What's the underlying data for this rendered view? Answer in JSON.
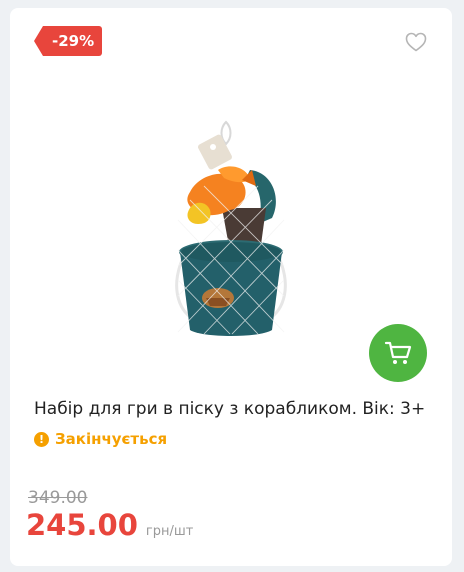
{
  "product": {
    "discount_badge": "-29%",
    "title": "Набір для гри в піску з корабликом. Вік: 3+",
    "stock_status": "Закінчується",
    "old_price": "349.00",
    "current_price": "245.00",
    "price_unit": "грн/шт"
  },
  "icons": {
    "favorite": "heart-outline-icon",
    "cart": "cart-icon",
    "stock": "exclamation-circle-icon"
  },
  "colors": {
    "badge": "#e8453c",
    "price": "#e8453c",
    "cart_button": "#4fb541",
    "stock": "#f5a000"
  }
}
